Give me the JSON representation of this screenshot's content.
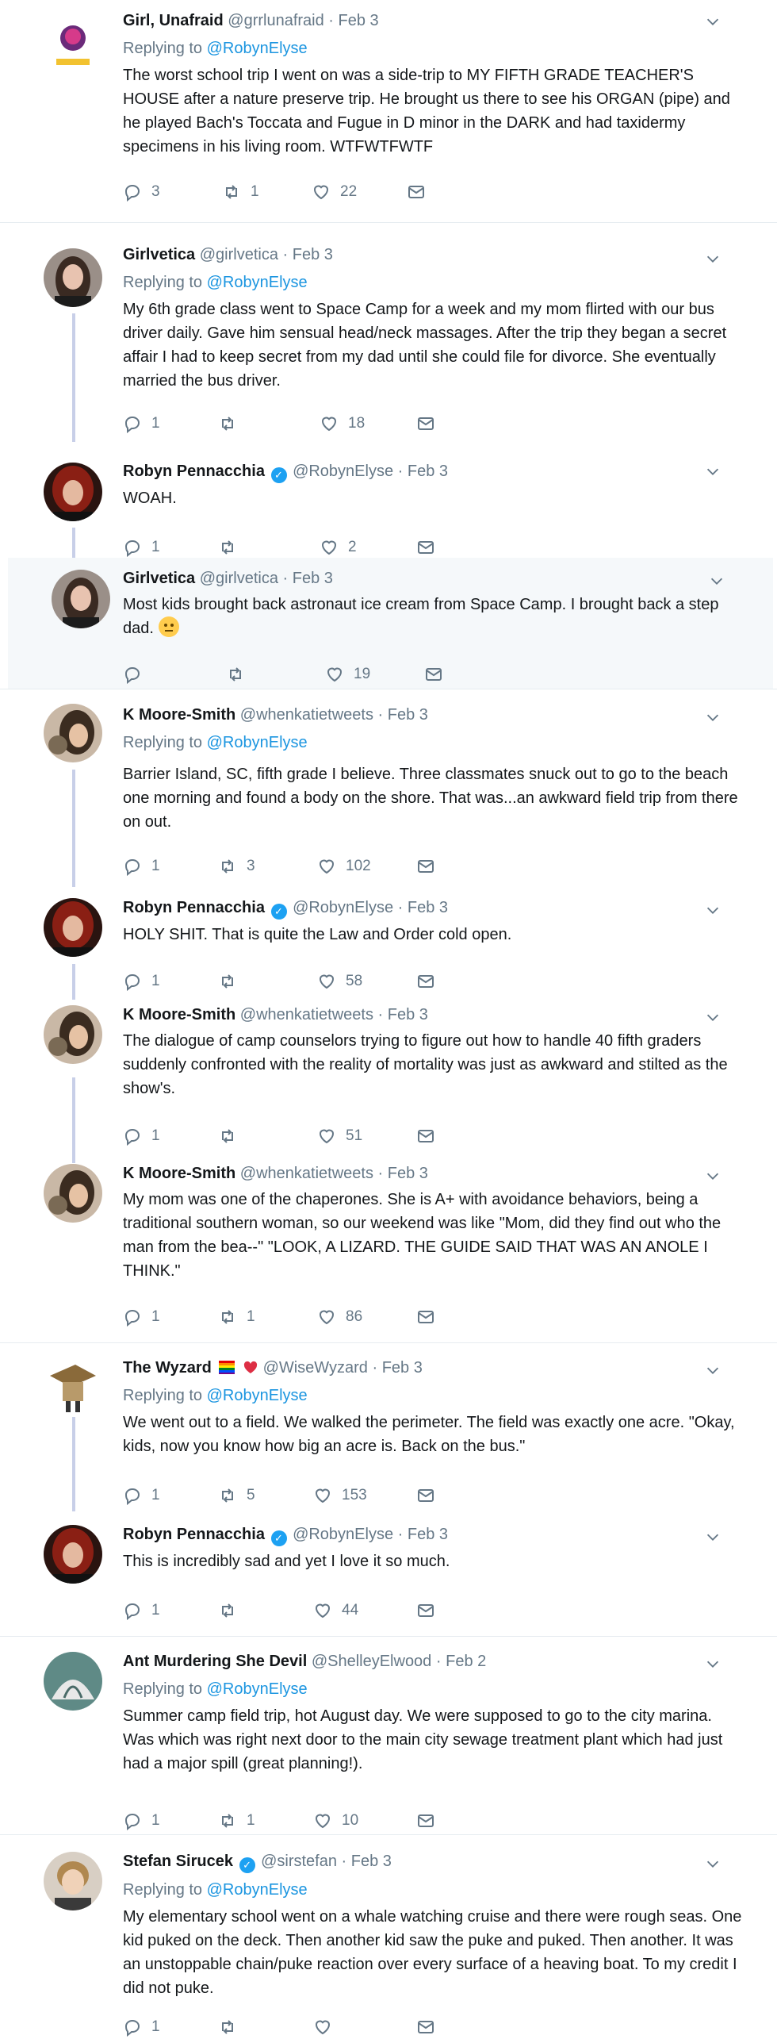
{
  "colors": {
    "link": "#1b95e0",
    "muted": "#657786",
    "text": "#14171a",
    "verified": "#1da1f2",
    "highlight_bg": "#f5f8fa",
    "thread_line": "#c8cfe8"
  },
  "tweets": [
    {
      "name": "Girl, Unafraid",
      "handle": "@grrlunafraid",
      "time": "Feb 3",
      "reply_label": "Replying to",
      "reply_handle": "@RobynElyse",
      "text": "The worst school trip I went on was a side-trip to MY FIFTH GRADE TEACHER'S HOUSE after a nature preserve trip. He brought us there to see his ORGAN (pipe) and he played Bach's Toccata and Fugue in D minor in the DARK and had taxidermy specimens in his living room. WTFWTFWTF",
      "replies": "3",
      "retweets": "1",
      "likes": "22"
    },
    {
      "name": "Girlvetica",
      "handle": "@girlvetica",
      "time": "Feb 3",
      "reply_label": "Replying to",
      "reply_handle": "@RobynElyse",
      "text": "My 6th grade class went to Space Camp for a week and my mom flirted with our bus driver daily. Gave him sensual head/neck massages. After the trip they began a secret affair I had to keep secret from my dad until she could file for divorce. She eventually married the bus driver.",
      "replies": "1",
      "retweets": "",
      "likes": "18"
    },
    {
      "name": "Robyn Pennacchia",
      "handle": "@RobynElyse",
      "time": "Feb 3",
      "text": "WOAH.",
      "replies": "1",
      "retweets": "",
      "likes": "2"
    },
    {
      "name": "Girlvetica",
      "handle": "@girlvetica",
      "time": "Feb 3",
      "text": "Most kids brought back astronaut ice cream from Space Camp. I brought back a step dad.",
      "replies": "",
      "retweets": "",
      "likes": "19"
    },
    {
      "name": "K Moore-Smith",
      "handle": "@whenkatietweets",
      "time": "Feb 3",
      "reply_label": "Replying to",
      "reply_handle": "@RobynElyse",
      "text": "Barrier Island, SC, fifth grade I believe. Three classmates snuck out to go to the beach one morning and found a body on the shore. That was...an awkward field trip from there on out.",
      "replies": "1",
      "retweets": "3",
      "likes": "102"
    },
    {
      "name": "Robyn Pennacchia",
      "handle": "@RobynElyse",
      "time": "Feb 3",
      "text": "HOLY SHIT. That is quite the Law and Order cold open.",
      "replies": "1",
      "retweets": "",
      "likes": "58"
    },
    {
      "name": "K Moore-Smith",
      "handle": "@whenkatietweets",
      "time": "Feb 3",
      "text": "The dialogue of camp counselors trying to figure out how to handle 40 fifth graders suddenly confronted with the reality of mortality was just as awkward and stilted as the show's.",
      "replies": "1",
      "retweets": "",
      "likes": "51"
    },
    {
      "name": "K Moore-Smith",
      "handle": "@whenkatietweets",
      "time": "Feb 3",
      "text": "My mom was one of the chaperones. She is A+ with avoidance behaviors, being a traditional southern woman, so our weekend was like \"Mom, did they find out who the man from the bea--\" \"LOOK, A LIZARD. THE GUIDE SAID THAT WAS AN ANOLE I THINK.\"",
      "replies": "1",
      "retweets": "1",
      "likes": "86"
    },
    {
      "name": "The Wyzard",
      "handle": "@WiseWyzard",
      "time": "Feb 3",
      "reply_label": "Replying to",
      "reply_handle": "@RobynElyse",
      "text": "We went out to a field. We walked the perimeter. The field was exactly one acre. \"Okay, kids, now you know how big an acre is. Back on the bus.\"",
      "replies": "1",
      "retweets": "5",
      "likes": "153"
    },
    {
      "name": "Robyn Pennacchia",
      "handle": "@RobynElyse",
      "time": "Feb 3",
      "text": "This is incredibly sad and yet I love it so much.",
      "replies": "1",
      "retweets": "",
      "likes": "44"
    },
    {
      "name": "Ant Murdering She Devil",
      "handle": "@ShelleyElwood",
      "time": "Feb 2",
      "reply_label": "Replying to",
      "reply_handle": "@RobynElyse",
      "text": "Summer camp field trip, hot August day. We were supposed to go to the city marina. Was which was right next door to the main city sewage treatment plant which had just had a major spill (great planning!).",
      "replies": "1",
      "retweets": "1",
      "likes": "10"
    },
    {
      "name": "Stefan Sirucek",
      "handle": "@sirstefan",
      "time": "Feb 3",
      "reply_label": "Replying to",
      "reply_handle": "@RobynElyse",
      "text": "My elementary school went on a whale watching cruise and there were rough seas. One kid puked on the deck. Then another kid saw the puke and puked. Then another. It was an unstoppable chain/puke reaction over every surface of a heaving boat. To my credit I did not  puke.",
      "replies": "1",
      "retweets": "",
      "likes": ""
    }
  ]
}
